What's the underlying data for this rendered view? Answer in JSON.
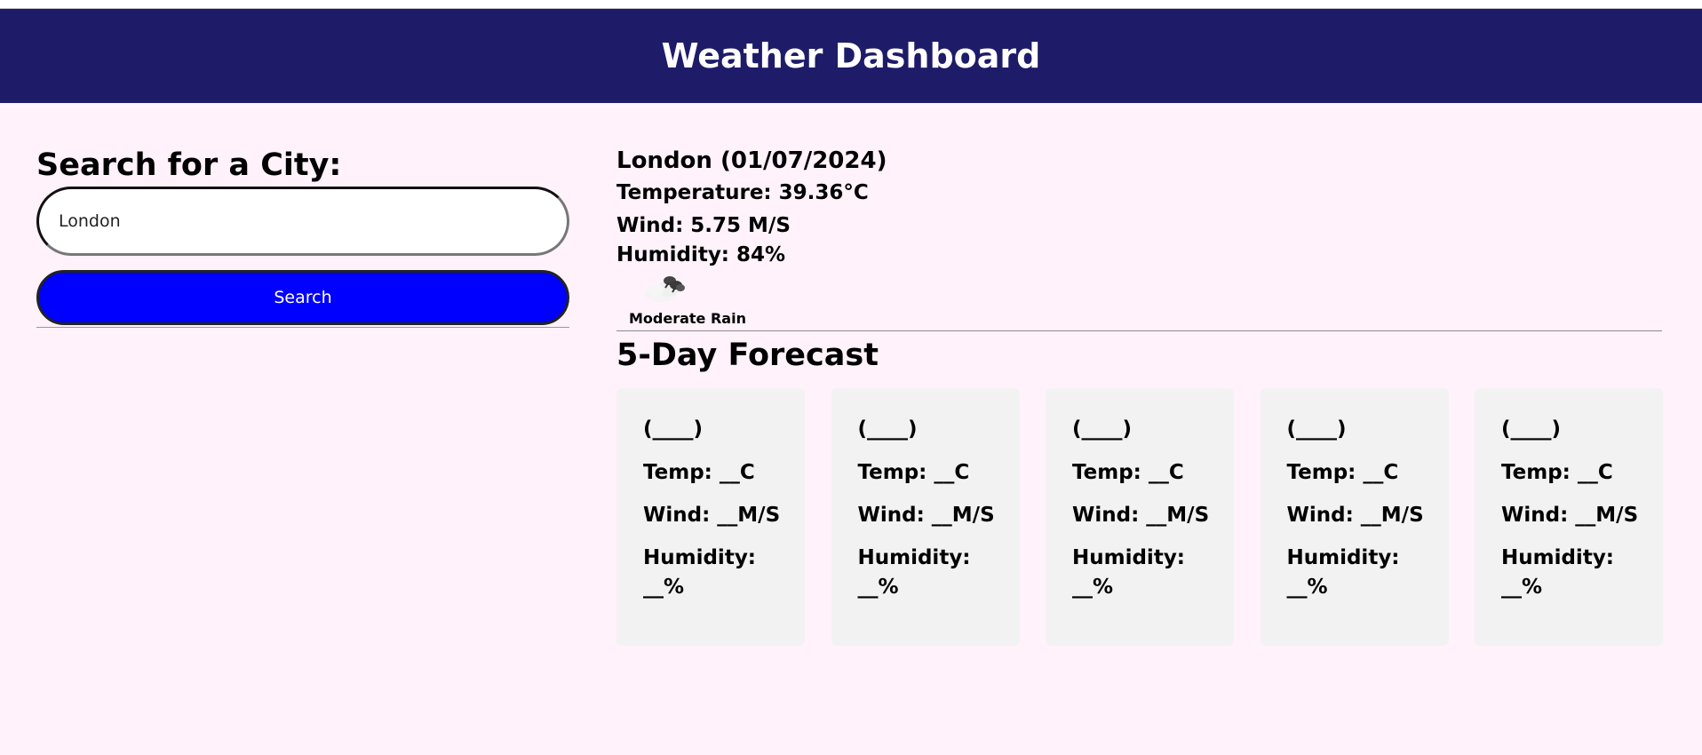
{
  "header": {
    "title": "Weather Dashboard"
  },
  "search": {
    "heading": "Search for a City:",
    "input_value": "London",
    "button_label": "Search"
  },
  "current": {
    "title": "London (01/07/2024)",
    "temperature": "Temperature: 39.36°C",
    "wind": "Wind: 5.75 M/S",
    "humidity": "Humidity: 84%",
    "icon": "rain-cloud-icon",
    "condition": "Moderate Rain"
  },
  "forecast": {
    "heading": "5-Day Forecast",
    "days": [
      {
        "date": "(____)",
        "temp": "Temp: __C",
        "wind": "Wind: __M/S",
        "humidity": "Humidity: __%"
      },
      {
        "date": "(____)",
        "temp": "Temp: __C",
        "wind": "Wind: __M/S",
        "humidity": "Humidity: __%"
      },
      {
        "date": "(____)",
        "temp": "Temp: __C",
        "wind": "Wind: __M/S",
        "humidity": "Humidity: __%"
      },
      {
        "date": "(____)",
        "temp": "Temp: __C",
        "wind": "Wind: __M/S",
        "humidity": "Humidity: __%"
      },
      {
        "date": "(____)",
        "temp": "Temp: __C",
        "wind": "Wind: __M/S",
        "humidity": "Humidity: __%"
      }
    ]
  },
  "colors": {
    "header_bg": "#1e1c69",
    "page_bg": "#fff2fa",
    "button_bg": "#0000fe",
    "card_bg": "#f2f2f2"
  }
}
